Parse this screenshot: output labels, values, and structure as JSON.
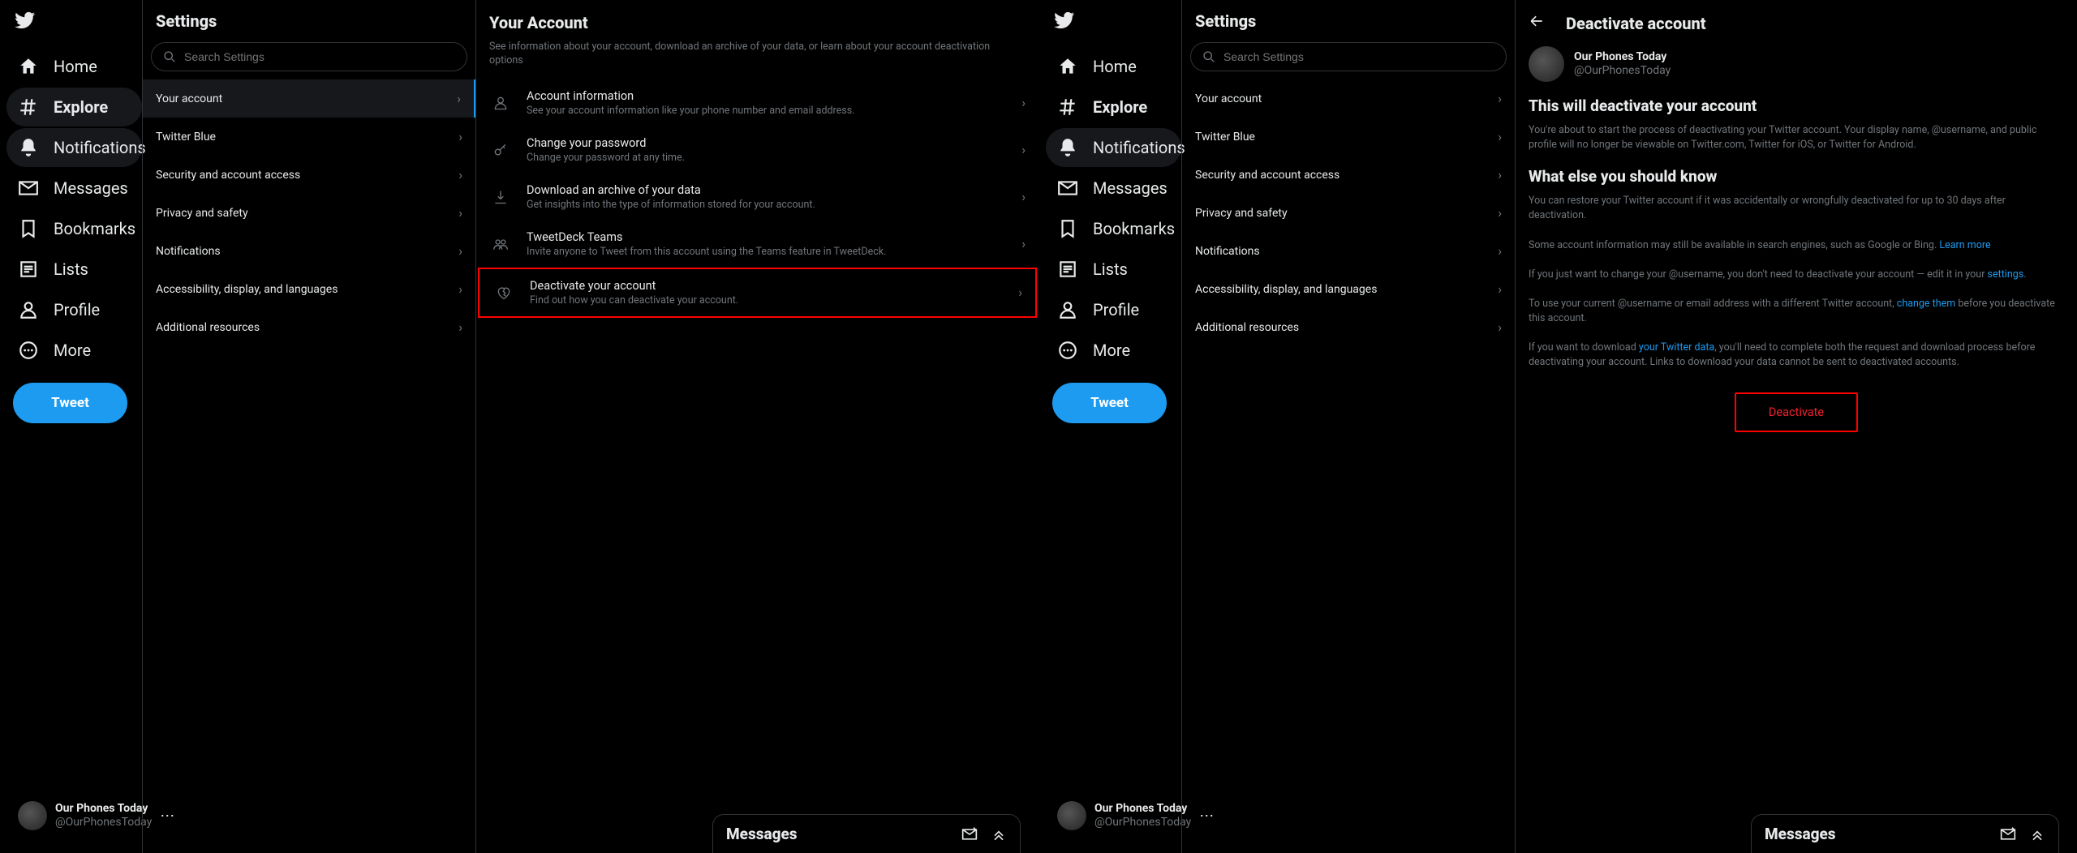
{
  "nav": {
    "items": [
      {
        "label": "Home",
        "icon": "home"
      },
      {
        "label": "Explore",
        "icon": "hash"
      },
      {
        "label": "Notifications",
        "icon": "bell"
      },
      {
        "label": "Messages",
        "icon": "mail"
      },
      {
        "label": "Bookmarks",
        "icon": "bookmark"
      },
      {
        "label": "Lists",
        "icon": "list"
      },
      {
        "label": "Profile",
        "icon": "person"
      },
      {
        "label": "More",
        "icon": "more"
      }
    ],
    "tweet": "Tweet",
    "account": {
      "name": "Our Phones Today",
      "handle": "@OurPhonesToday"
    }
  },
  "settings": {
    "title": "Settings",
    "search_placeholder": "Search Settings",
    "items": [
      "Your account",
      "Twitter Blue",
      "Security and account access",
      "Privacy and safety",
      "Notifications",
      "Accessibility, display, and languages",
      "Additional resources"
    ]
  },
  "left_detail": {
    "title": "Your Account",
    "desc": "See information about your account, download an archive of your data, or learn about your account deactivation options",
    "options": [
      {
        "title": "Account information",
        "sub": "See your account information like your phone number and email address.",
        "icon": "person"
      },
      {
        "title": "Change your password",
        "sub": "Change your password at any time.",
        "icon": "key"
      },
      {
        "title": "Download an archive of your data",
        "sub": "Get insights into the type of information stored for your account.",
        "icon": "download"
      },
      {
        "title": "TweetDeck Teams",
        "sub": "Invite anyone to Tweet from this account using the Teams feature in TweetDeck.",
        "icon": "people"
      },
      {
        "title": "Deactivate your account",
        "sub": "Find out how you can deactivate your account.",
        "icon": "heartbreak"
      }
    ]
  },
  "right_detail": {
    "title": "Deactivate account",
    "user": {
      "name": "Our Phones Today",
      "handle": "@OurPhonesToday"
    },
    "h1": "This will deactivate your account",
    "p1": "You're about to start the process of deactivating your Twitter account. Your display name, @username, and public profile will no longer be viewable on Twitter.com, Twitter for iOS, or Twitter for Android.",
    "h2": "What else you should know",
    "p2": "You can restore your Twitter account if it was accidentally or wrongfully deactivated for up to 30 days after deactivation.",
    "p3a": "Some account information may still be available in search engines, such as Google or Bing. ",
    "p3link": "Learn more",
    "p4a": "If you just want to change your @username, you don't need to deactivate your account — edit it in your ",
    "p4link": "settings",
    "p4b": ".",
    "p5a": "To use your current @username or email address with a different Twitter account, ",
    "p5link": "change them",
    "p5b": " before you deactivate this account.",
    "p6a": "If you want to download ",
    "p6link": "your Twitter data",
    "p6b": ", you'll need to complete both the request and download process before deactivating your account. Links to download your data cannot be sent to deactivated accounts.",
    "button": "Deactivate"
  },
  "dock": {
    "title": "Messages"
  }
}
